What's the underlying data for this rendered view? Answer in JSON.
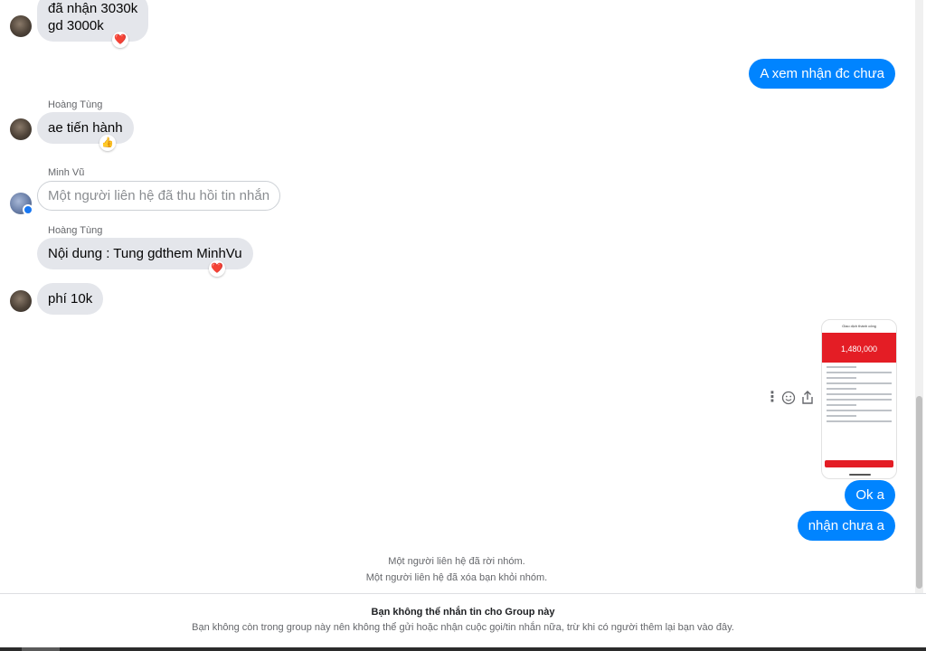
{
  "messages": {
    "m1": {
      "lines": [
        "đã nhận 3030k",
        "gd 3000k"
      ],
      "reaction": "❤️"
    },
    "m2": {
      "text": "A xem nhận đc chưa"
    },
    "m3": {
      "sender": "Hoàng Tùng",
      "text": "ae tiến hành",
      "reaction": "👍"
    },
    "m4": {
      "sender": "Minh Vũ",
      "text": "Một người liên hệ đã thu hồi tin nhắn"
    },
    "m5": {
      "sender": "Hoàng Tùng",
      "text": "Nội dung : Tung gdthem MinhVu",
      "reaction": "❤️"
    },
    "m6": {
      "text": "phí 10k"
    },
    "m7": {
      "receipt": {
        "title": "Giao dịch thành công",
        "amount": "1,480,000"
      }
    },
    "m8": {
      "text": "Ok a"
    },
    "m9": {
      "text": "nhận chưa a"
    }
  },
  "system": {
    "left_group": "Một người liên hệ đã rời nhóm.",
    "removed_you": "Một người liên hệ đã xóa bạn khỏi nhóm."
  },
  "footer": {
    "title": "Bạn không thể nhắn tin cho Group này",
    "subtitle": "Bạn không còn trong group này nên không thể gửi hoặc nhận cuộc gọi/tin nhắn nữa, trừ khi có người thêm lại bạn vào đây."
  },
  "icons": {
    "more": "more-vertical-icon",
    "react": "smiley-icon",
    "share": "share-icon"
  },
  "colors": {
    "outgoing_bubble": "#0084ff",
    "incoming_bubble": "#e4e6eb"
  }
}
